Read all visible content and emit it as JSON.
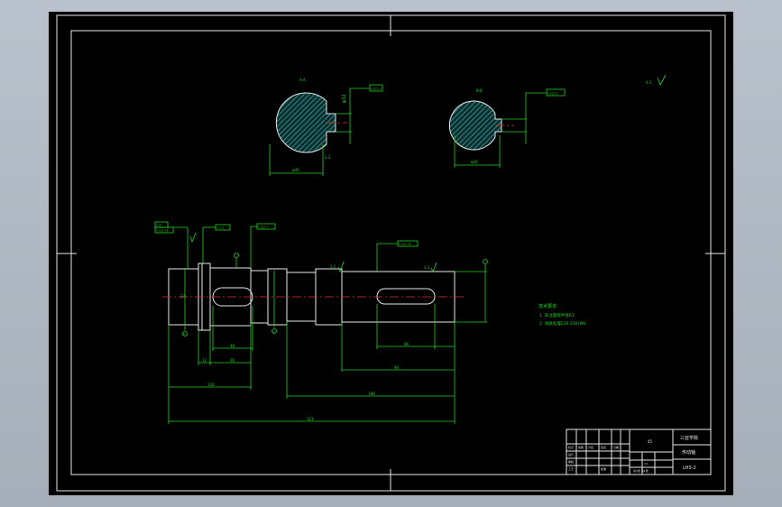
{
  "colors": {
    "background": "#000000",
    "outer_chrome": "#b3bbc6",
    "drawing_lines": "#e8e8e8",
    "dimensions": "#21d321",
    "centerline": "#e03030",
    "section_hatch": "#2aa6a6"
  },
  "sections": {
    "left_label": "A-A",
    "right_label": "B-B",
    "left_tolerance": "0.025 A",
    "right_tolerance": "0.025 A",
    "left_dia": "φ45",
    "right_dia": "φ32"
  },
  "shaft": {
    "tol_box_1a": "0.02",
    "tol_box_1b": "0.015 AB",
    "tol_box_2": "0.025",
    "tol_box_3": "0.025 A",
    "tol_box_4": "0.025 AB",
    "datum_a": "A",
    "datum_b": "B",
    "dims": {
      "d1": "48",
      "d2": "66",
      "d3": "102",
      "d4": "188",
      "d5": "321",
      "d6": "90",
      "d7": "26",
      "d8": "37",
      "d9": "12"
    },
    "roughness": "3.2",
    "roughness_corner": "6.3"
  },
  "notes": {
    "title": "技术要求:",
    "line1": "1. 未注圆角半径R1",
    "line2": "2. 调质处理220-250HBS"
  },
  "title_block": {
    "school": "三亚学院",
    "part_name": "传动轴",
    "drawing_no": "LHS-2",
    "material": "45",
    "scale": "1:1",
    "sheet": "共1张 第1张",
    "rows": [
      "标记",
      "处数",
      "分区",
      "签名",
      "日期"
    ],
    "roles": [
      "设计",
      "审核",
      "工艺",
      "批准"
    ]
  }
}
